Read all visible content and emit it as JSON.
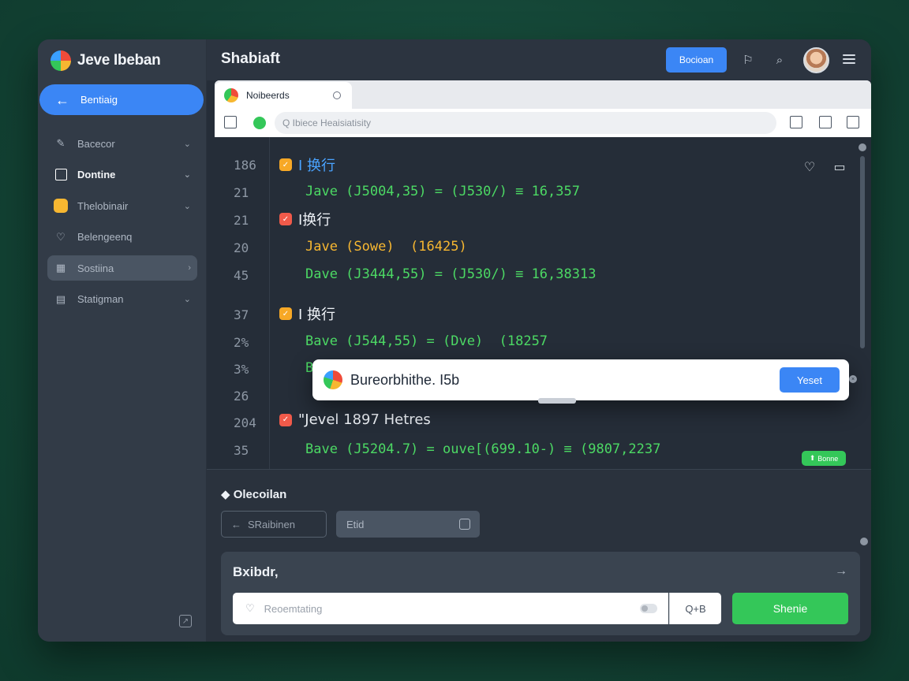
{
  "brand": {
    "title": "Jeve Ibeban"
  },
  "sidebar": {
    "back_label": "Bentiaig",
    "items": [
      {
        "label": "Bacecor",
        "icon": "edit-icon"
      },
      {
        "label": "Dontine",
        "icon": "checkbox-icon"
      },
      {
        "label": "Thelobinair",
        "icon": "app-icon"
      },
      {
        "label": "Belengeenq",
        "icon": "heart-icon"
      },
      {
        "label": "Sostiina",
        "icon": "grid-icon"
      },
      {
        "label": "Statigman",
        "icon": "calendar-icon"
      }
    ]
  },
  "header": {
    "title": "Shabiaft",
    "button_label": "Bocioan"
  },
  "browser": {
    "tab_label": "Noibeerds",
    "url_text": "Q Ibiece Heaisiatisity"
  },
  "code": {
    "lines": [
      {
        "num": "186",
        "kind": "head",
        "text": "I 换行"
      },
      {
        "num": "21",
        "kind": "code",
        "text": "Jave (J5004,35) = (J530/) ≡ 16,357"
      },
      {
        "num": "21",
        "kind": "head",
        "text": "I换行"
      },
      {
        "num": "20",
        "kind": "code",
        "text": "Jave (Sowe)  (16425)"
      },
      {
        "num": "45",
        "kind": "code",
        "text": "Dave (J3444,55) = (J530/) ≡ 16,38313"
      },
      {
        "num": "37",
        "kind": "head",
        "text": "I 换行"
      },
      {
        "num": "2%",
        "kind": "code",
        "text": "Bave (J544,55) = (Dve)  (18257"
      },
      {
        "num": "3%",
        "kind": "code",
        "text": "B"
      },
      {
        "num": "26",
        "kind": "code",
        "text": ""
      },
      {
        "num": "204",
        "kind": "head2",
        "text": "\"Jevel  1897  Hetres"
      },
      {
        "num": "35",
        "kind": "code",
        "text": "Bave (J5204.7) = ouve[(699.10-) ≡ (9807,2237"
      }
    ],
    "badge_label": "Bonne"
  },
  "popup": {
    "text": "Bureorbhithe. I5b",
    "button_label": "Yeset"
  },
  "bottom": {
    "section_title": "Olecoilan",
    "outline_button": "SRaibinen",
    "input_value": "Etid",
    "card_title": "Bxibdr,",
    "message_placeholder": "Reoemtating",
    "search_label": "Q+B",
    "share_label": "Shenie"
  },
  "colors": {
    "accent_blue": "#3b86f5",
    "accent_green": "#34c759",
    "sidebar_bg": "#323b47",
    "code_green": "#4cd964",
    "code_yellow": "#f7b731",
    "code_cyan": "#4fc3f7"
  }
}
